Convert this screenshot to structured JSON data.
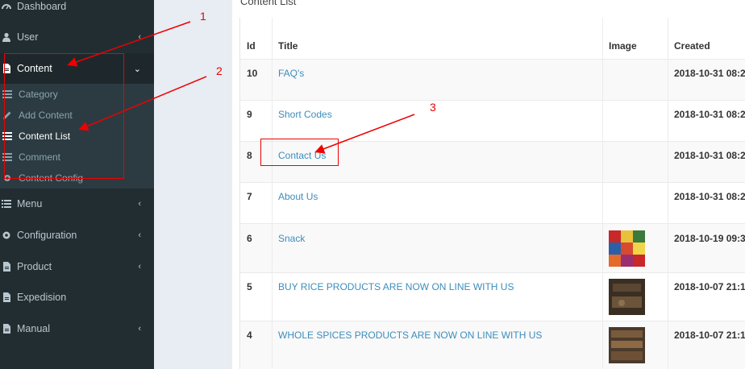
{
  "sidebar": {
    "items": [
      {
        "label": "Dashboard",
        "icon": "dashboard-icon"
      },
      {
        "label": "User",
        "icon": "user-icon"
      },
      {
        "label": "Content",
        "icon": "file-icon"
      },
      {
        "label": "Menu",
        "icon": "list-icon"
      },
      {
        "label": "Configuration",
        "icon": "gear-icon"
      },
      {
        "label": "Product",
        "icon": "file-icon"
      },
      {
        "label": "Expedision",
        "icon": "file-icon"
      },
      {
        "label": "Manual",
        "icon": "file-icon"
      }
    ],
    "content_submenu": [
      {
        "label": "Category",
        "icon": "list-icon"
      },
      {
        "label": "Add Content",
        "icon": "pencil-icon"
      },
      {
        "label": "Content List",
        "icon": "list-icon"
      },
      {
        "label": "Comment",
        "icon": "list-icon"
      },
      {
        "label": "Content Config",
        "icon": "gear-icon"
      }
    ]
  },
  "main": {
    "title": "Content List",
    "columns": [
      "Id",
      "Title",
      "Image",
      "Created"
    ],
    "rows": [
      {
        "id": "10",
        "title": "FAQ's",
        "image": "",
        "created": "2018-10-31 08:2"
      },
      {
        "id": "9",
        "title": "Short Codes",
        "image": "",
        "created": "2018-10-31 08:2"
      },
      {
        "id": "8",
        "title": "Contact Us",
        "image": "",
        "created": "2018-10-31 08:2"
      },
      {
        "id": "7",
        "title": "About Us",
        "image": "",
        "created": "2018-10-31 08:2"
      },
      {
        "id": "6",
        "title": "Snack",
        "image": "snack-thumbnail",
        "created": "2018-10-19 09:3"
      },
      {
        "id": "5",
        "title": "BUY RICE PRODUCTS ARE NOW ON LINE WITH US",
        "image": "rice-thumbnail",
        "created": "2018-10-07 21:1"
      },
      {
        "id": "4",
        "title": "WHOLE SPICES PRODUCTS ARE NOW ON LINE WITH US",
        "image": "spices-thumbnail",
        "created": "2018-10-07 21:1"
      }
    ]
  },
  "annotations": {
    "n1": "1",
    "n2": "2",
    "n3": "3",
    "color": "#e00000"
  },
  "colors": {
    "sidebar": "#222d32",
    "submenu": "#2c3b41",
    "link": "#3c8dbc"
  }
}
